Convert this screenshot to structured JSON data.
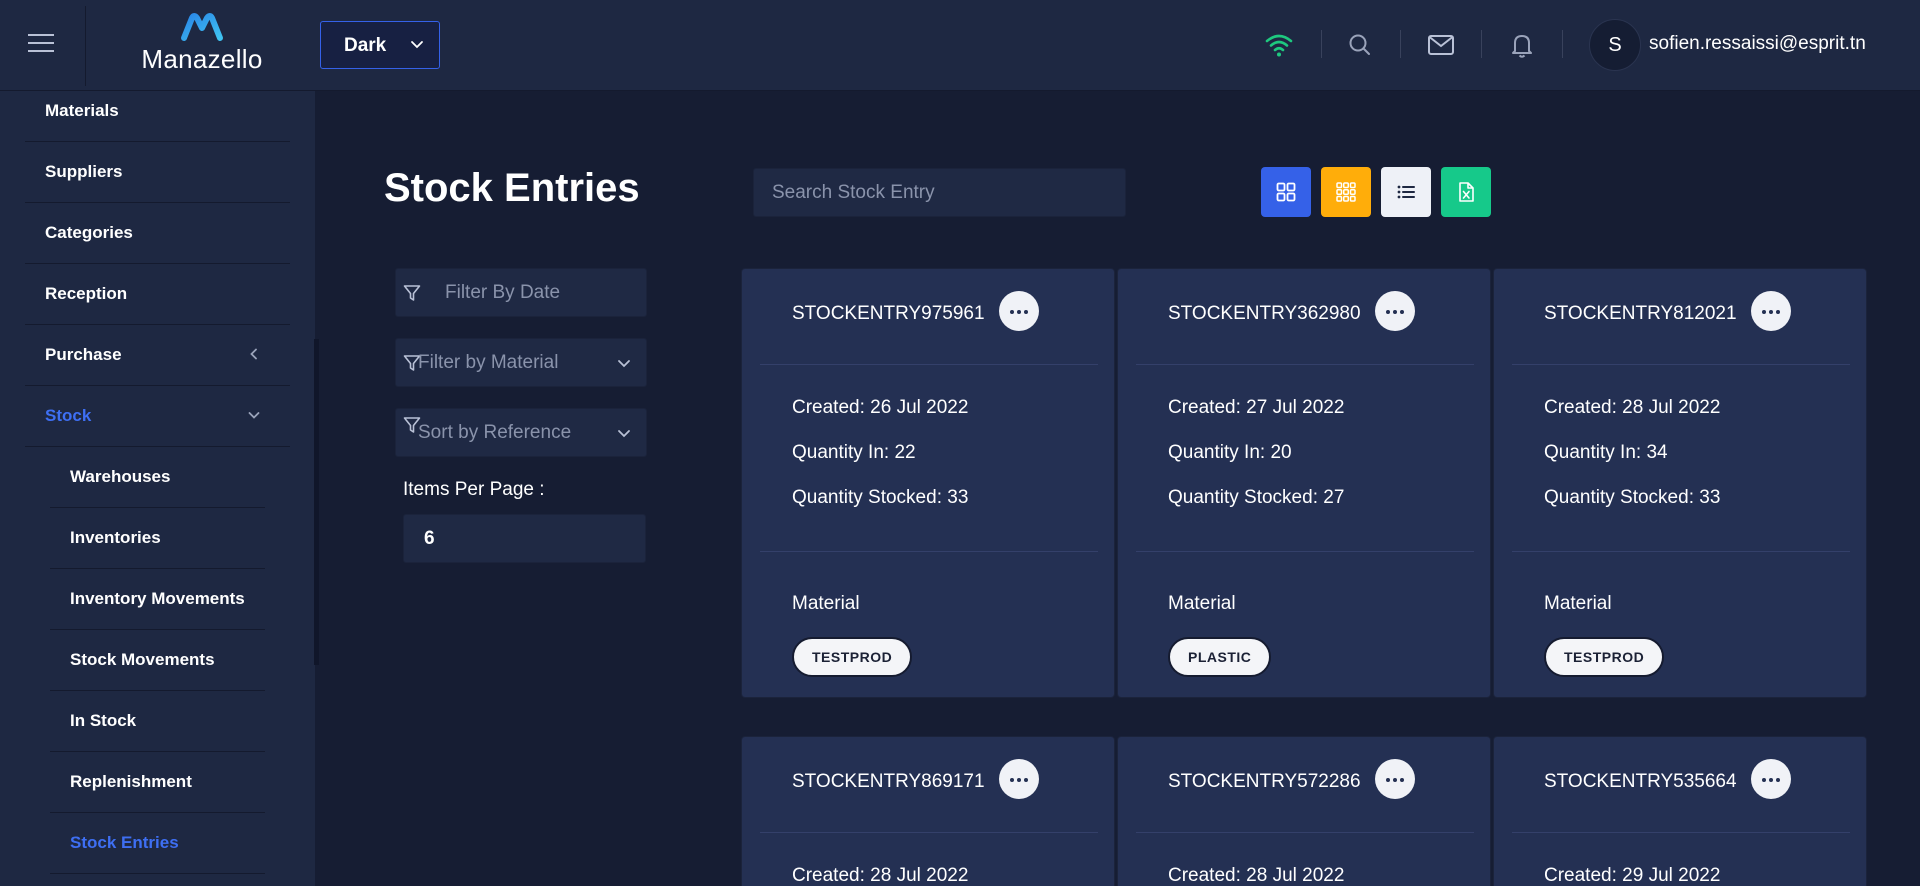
{
  "header": {
    "app_name": "Manazello",
    "theme": "Dark",
    "user_initial": "S",
    "user_email": "sofien.ressaissi@esprit.tn",
    "icons": [
      "menu-icon",
      "wifi-icon",
      "search-icon",
      "mail-icon",
      "bell-icon"
    ]
  },
  "sidebar": {
    "items": [
      {
        "label": "Materials"
      },
      {
        "label": "Suppliers"
      },
      {
        "label": "Categories"
      },
      {
        "label": "Reception"
      },
      {
        "label": "Purchase"
      },
      {
        "label": "Stock"
      }
    ],
    "stock_children": [
      {
        "label": "Warehouses"
      },
      {
        "label": "Inventories"
      },
      {
        "label": "Inventory Movements"
      },
      {
        "label": "Stock Movements"
      },
      {
        "label": "In Stock"
      },
      {
        "label": "Replenishment"
      },
      {
        "label": "Stock Entries"
      }
    ],
    "active_item": "Stock",
    "active_child": "Stock Entries"
  },
  "main": {
    "title": "Stock Entries",
    "search_placeholder": "Search Stock Entry",
    "view_buttons": [
      "grid-view-icon",
      "apps-view-icon",
      "list-view-icon",
      "excel-export-icon"
    ],
    "filters": {
      "date": "Filter By Date",
      "material": "Filter by Material",
      "sort": "Sort by Reference"
    },
    "items_per_page_label": "Items Per Page :",
    "items_per_page": "6"
  },
  "cards": [
    {
      "reference": "STOCKENTRY975961",
      "created": "Created: 26 Jul 2022",
      "quantity_in": "Quantity In: 22",
      "quantity_stocked": "Quantity Stocked: 33",
      "material_label": "Material",
      "material": "TESTPROD"
    },
    {
      "reference": "STOCKENTRY362980",
      "created": "Created: 27 Jul 2022",
      "quantity_in": "Quantity In: 20",
      "quantity_stocked": "Quantity Stocked: 27",
      "material_label": "Material",
      "material": "PLASTIC"
    },
    {
      "reference": "STOCKENTRY812021",
      "created": "Created: 28 Jul 2022",
      "quantity_in": "Quantity In: 34",
      "quantity_stocked": "Quantity Stocked: 33",
      "material_label": "Material",
      "material": "TESTPROD"
    },
    {
      "reference": "STOCKENTRY869171",
      "created": "Created: 28 Jul 2022"
    },
    {
      "reference": "STOCKENTRY572286",
      "created": "Created: 28 Jul 2022"
    },
    {
      "reference": "STOCKENTRY535664",
      "created": "Created: 29 Jul 2022"
    }
  ],
  "colors": {
    "accent": "#3e6ff3",
    "grid_button": "#3561e8",
    "apps_button": "#ffad0a",
    "list_button": "#eef1f7",
    "excel_button": "#16c98a",
    "wifi": "#1ec97f"
  }
}
